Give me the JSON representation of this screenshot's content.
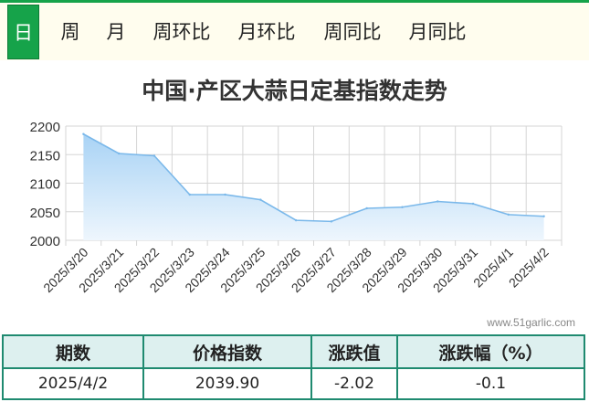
{
  "tabs": [
    {
      "label": "日",
      "active": true
    },
    {
      "label": "周",
      "active": false
    },
    {
      "label": "月",
      "active": false
    },
    {
      "label": "周环比",
      "active": false
    },
    {
      "label": "月环比",
      "active": false
    },
    {
      "label": "周同比",
      "active": false
    },
    {
      "label": "月同比",
      "active": false
    }
  ],
  "chart_data": {
    "type": "area",
    "title": "中国·产区大蒜日定基指数走势",
    "categories": [
      "2025/3/20",
      "2025/3/21",
      "2025/3/22",
      "2025/3/23",
      "2025/3/24",
      "2025/3/25",
      "2025/3/26",
      "2025/3/27",
      "2025/3/28",
      "2025/3/29",
      "2025/3/30",
      "2025/3/31",
      "2025/4/1",
      "2025/4/2"
    ],
    "series": [
      {
        "values": [
          2186,
          2152,
          2148,
          2080,
          2080,
          2071,
          2035,
          2033,
          2056,
          2058,
          2068,
          2064,
          2045,
          2042
        ]
      }
    ],
    "ylim": [
      2000,
      2200
    ],
    "yticks": [
      2000,
      2050,
      2100,
      2150,
      2200
    ],
    "grid": true,
    "colors": {
      "line": "#7ab8ea",
      "fill_top": "#a9d3f5",
      "fill_bottom": "#eef6fd",
      "grid": "#d5d5d5"
    }
  },
  "watermark": "www.51garlic.com",
  "summary": {
    "headers": [
      "期数",
      "价格指数",
      "涨跌值",
      "涨跌幅（%）"
    ],
    "row": [
      "2025/4/2",
      "2039.90",
      "-2.02",
      "-0.1"
    ]
  }
}
